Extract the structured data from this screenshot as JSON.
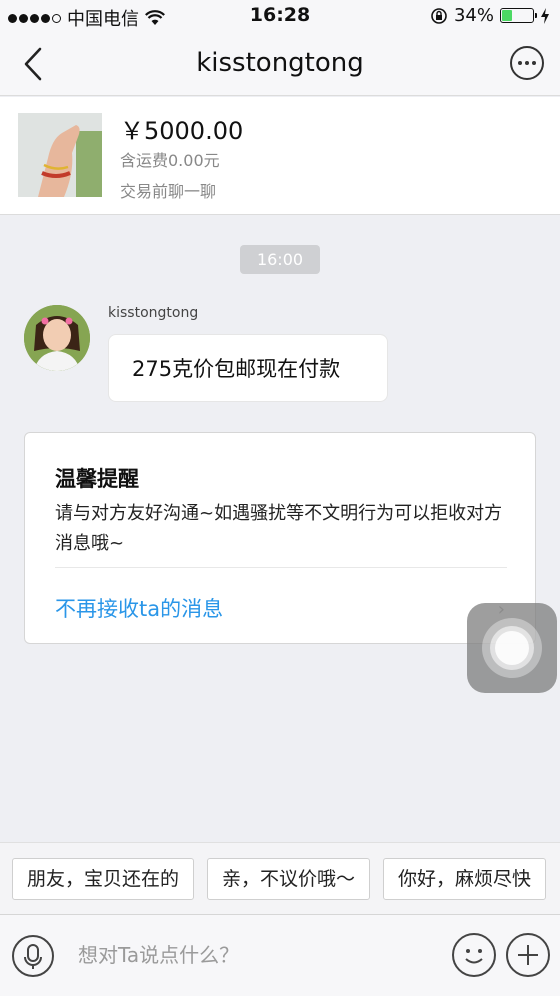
{
  "status_bar": {
    "carrier": "中国电信",
    "time": "16:28",
    "battery_percent": "34%",
    "battery_level": 0.34,
    "battery_color": "#4cd964"
  },
  "nav": {
    "back_icon": "chevron-left-icon",
    "title": "kisstongtong",
    "more_icon": "more-dots-icon"
  },
  "product": {
    "price": "￥5000.00",
    "shipping": "含运费0.00元",
    "note": "交易前聊一聊"
  },
  "chat": {
    "time": "16:00",
    "sender": "kisstongtong",
    "message": "275克价包邮现在付款"
  },
  "reminder": {
    "title": "温馨提醒",
    "body": "请与对方友好沟通~如遇骚扰等不文明行为可以拒收对方消息哦~",
    "link": "不再接收ta的消息",
    "link_color": "#2a96e8"
  },
  "quick_replies": [
    "朋友，宝贝还在的",
    "亲，不议价哦～",
    "你好，麻烦尽快"
  ],
  "input": {
    "placeholder": "想对Ta说点什么？"
  }
}
